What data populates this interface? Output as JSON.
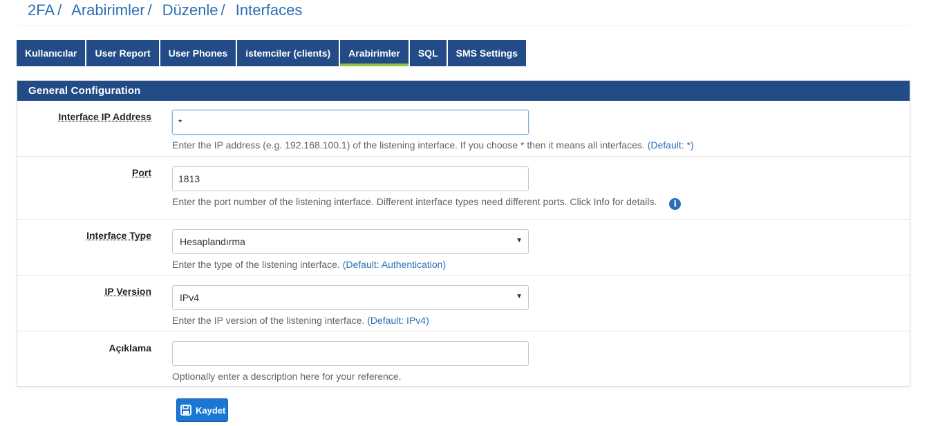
{
  "breadcrumb": {
    "items": [
      "2FA",
      "Arabirimler",
      "Düzenle",
      "Interfaces"
    ],
    "separator": "/"
  },
  "tabs": [
    {
      "label": "Kullanıcılar"
    },
    {
      "label": "User Report"
    },
    {
      "label": "User Phones"
    },
    {
      "label": "istemciler (clients)"
    },
    {
      "label": "Arabirimler",
      "active": true
    },
    {
      "label": "SQL"
    },
    {
      "label": "SMS Settings"
    }
  ],
  "panel": {
    "heading": "General Configuration",
    "fields": {
      "ip_address": {
        "label": "Interface IP Address",
        "value": "*",
        "help": "Enter the IP address (e.g. 192.168.100.1) of the listening interface. If you choose * then it means all interfaces.",
        "default": "(Default: *)"
      },
      "port": {
        "label": "Port",
        "value": "1813",
        "help": "Enter the port number of the listening interface. Different interface types need different ports. Click Info for details.",
        "info_icon": "info-circle-icon"
      },
      "interface_type": {
        "label": "Interface Type",
        "value": "Hesaplandırma",
        "help": "Enter the type of the listening interface.",
        "default": "(Default: Authentication)"
      },
      "ip_version": {
        "label": "IP Version",
        "value": "IPv4",
        "help": "Enter the IP version of the listening interface.",
        "default": "(Default: IPv4)"
      },
      "description": {
        "label": "Açıklama",
        "value": "",
        "help": "Optionally enter a description here for your reference."
      }
    }
  },
  "save_button": {
    "label": "Kaydet",
    "icon": "save-icon"
  },
  "colors": {
    "primary": "#224b87",
    "active_tab_underline": "#8cc63f",
    "link": "#2a6fb5",
    "button": "#1b77d4"
  }
}
